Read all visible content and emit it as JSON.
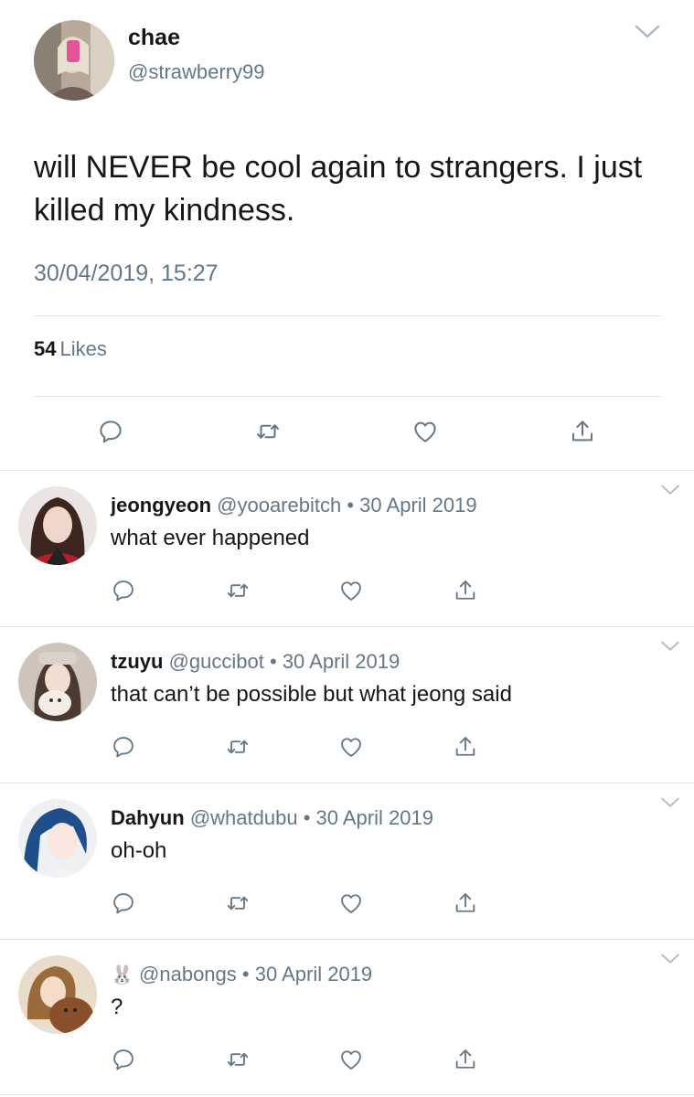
{
  "tweet": {
    "name": "chae",
    "handle": "@strawberry99",
    "text": "will NEVER be cool again to strangers. I just killed my kindness.",
    "timestamp": "30/04/2019, 15:27",
    "likes_count": "54",
    "likes_label": "Likes"
  },
  "replies": [
    {
      "name": "jeongyeon",
      "handle": "@yooarebitch",
      "date": "30 April 2019",
      "text": "what ever happened"
    },
    {
      "name": "tzuyu",
      "handle": "@guccibot",
      "date": "30 April 2019",
      "text": "that can’t be possible but what jeong said"
    },
    {
      "name": "Dahyun",
      "handle": "@whatdubu",
      "date": "30 April 2019",
      "text": "oh-oh"
    },
    {
      "name": "🐰",
      "handle": "@nabongs",
      "date": "30 April 2019",
      "text": "?"
    }
  ],
  "separator": "•",
  "icons": {
    "reply": "reply-icon",
    "retweet": "retweet-icon",
    "like": "heart-icon",
    "share": "share-icon",
    "menu": "chevron-down-icon"
  },
  "colors": {
    "text": "#14171a",
    "secondary": "#657786",
    "divider": "#dfe3e7",
    "icon": "#657786"
  }
}
